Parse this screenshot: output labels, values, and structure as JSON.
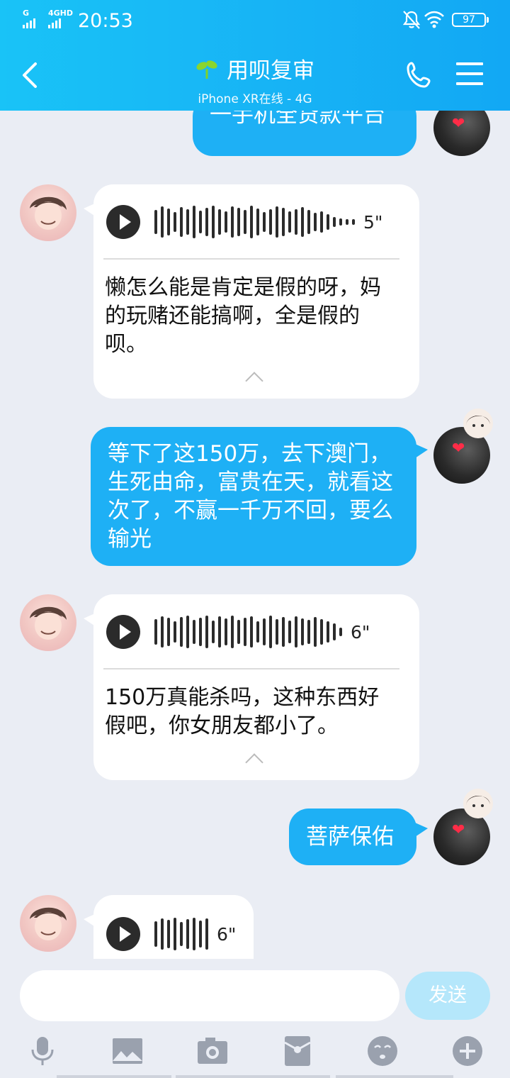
{
  "status_bar": {
    "signal1_label": "G",
    "signal2_label": "4GHD",
    "time": "20:53",
    "battery": "97",
    "icons": [
      "mute-icon",
      "wifi-icon",
      "battery-icon"
    ]
  },
  "header": {
    "back_icon": "chevron-left-icon",
    "title_icon": "sprout-icon",
    "title": "用呗复审",
    "subtitle": "iPhone XR在线 - 4G",
    "call_icon": "phone-icon",
    "menu_icon": "menu-icon",
    "background_color": "#17b3f5"
  },
  "messages": [
    {
      "from": "self",
      "type": "text",
      "text": "一手机全贷款平台"
    },
    {
      "from": "other",
      "type": "voice",
      "duration": "5\"",
      "transcript": "懒怎么能是肯定是假的呀，妈的玩赌还能搞啊，全是假的呗。"
    },
    {
      "from": "self",
      "type": "text",
      "text": "等下了这150万，去下澳门，生死由命，富贵在天，就看这次了，不赢一千万不回，要么输光"
    },
    {
      "from": "other",
      "type": "voice",
      "duration": "6\"",
      "transcript": "150万真能杀吗，这种东西好假吧，你女朋友都小了。"
    },
    {
      "from": "self",
      "type": "text",
      "text": "菩萨保佑"
    },
    {
      "from": "other",
      "type": "voice",
      "duration": "6\""
    }
  ],
  "input": {
    "placeholder": "",
    "value": "",
    "send_label": "发送"
  },
  "toolbar": {
    "items": [
      "microphone-icon",
      "image-icon",
      "camera-icon",
      "red-packet-icon",
      "emoji-icon",
      "plus-icon"
    ]
  },
  "colors": {
    "sent_bubble": "#1eb0f5",
    "received_bubble": "#ffffff",
    "chat_background": "#eaedf4",
    "send_button_disabled": "#b5e7fb"
  }
}
